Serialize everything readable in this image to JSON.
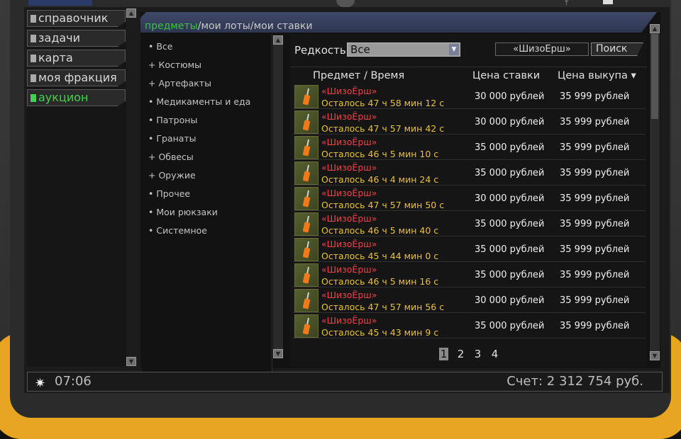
{
  "nav": {
    "items": [
      {
        "label": "справочник",
        "active": false
      },
      {
        "label": "задачи",
        "active": false
      },
      {
        "label": "карта",
        "active": false
      },
      {
        "label": "моя фракция",
        "active": false
      },
      {
        "label": "аукцион",
        "active": true
      }
    ]
  },
  "tabs": [
    {
      "label": "предметы",
      "active": true
    },
    {
      "label": "мои лоты",
      "active": false
    },
    {
      "label": "мои ставки",
      "active": false
    }
  ],
  "categories": [
    {
      "label": "• Все"
    },
    {
      "label": "+ Костюмы"
    },
    {
      "label": "+ Артефакты"
    },
    {
      "label": "• Медикаменты и еда"
    },
    {
      "label": "• Патроны"
    },
    {
      "label": "• Гранаты"
    },
    {
      "label": "+ Обвесы"
    },
    {
      "label": "+ Оружие"
    },
    {
      "label": "• Прочее"
    },
    {
      "label": "• Мои рюкзаки"
    },
    {
      "label": "• Системное"
    }
  ],
  "filter": {
    "rarity_label": "Редкость",
    "rarity_value": "Все",
    "search_value": "«ШизоЁрш»",
    "search_button": "Поиск"
  },
  "table": {
    "headers": {
      "item": "Предмет   /   Время",
      "bid": "Цена ставки",
      "buyout": "Цена выкупа ▾"
    },
    "rows": [
      {
        "name": "«ШизоЁрш»",
        "time": "Осталось 47 ч 58 мин 12 с",
        "bid": "30 000 рублей",
        "buyout": "35 999 рублей"
      },
      {
        "name": "«ШизоЁрш»",
        "time": "Осталось 47 ч 57 мин 42 с",
        "bid": "30 000 рублей",
        "buyout": "35 999 рублей"
      },
      {
        "name": "«ШизоЁрш»",
        "time": "Осталось 46 ч 5 мин 10 с",
        "bid": "35 000 рублей",
        "buyout": "35 999 рублей"
      },
      {
        "name": "«ШизоЁрш»",
        "time": "Осталось 46 ч 4 мин 24 с",
        "bid": "35 000 рублей",
        "buyout": "35 999 рублей"
      },
      {
        "name": "«ШизоЁрш»",
        "time": "Осталось 47 ч 57 мин 50 с",
        "bid": "30 000 рублей",
        "buyout": "35 999 рублей"
      },
      {
        "name": "«ШизоЁрш»",
        "time": "Осталось 46 ч 5 мин 40 с",
        "bid": "35 000 рублей",
        "buyout": "35 999 рублей"
      },
      {
        "name": "«ШизоЁрш»",
        "time": "Осталось 45 ч 44 мин 0 с",
        "bid": "35 000 рублей",
        "buyout": "35 999 рублей"
      },
      {
        "name": "«ШизоЁрш»",
        "time": "Осталось 46 ч 5 мин 16 с",
        "bid": "35 000 рублей",
        "buyout": "35 999 рублей"
      },
      {
        "name": "«ШизоЁрш»",
        "time": "Осталось 47 ч 57 мин 56 с",
        "bid": "30 000 рублей",
        "buyout": "35 999 рублей"
      },
      {
        "name": "«ШизоЁрш»",
        "time": "Осталось 45 ч 43 мин 9 с",
        "bid": "35 000 рублей",
        "buyout": "35 999 рублей"
      }
    ]
  },
  "pagination": {
    "pages": [
      "1",
      "2",
      "3",
      "4"
    ],
    "current": "1"
  },
  "status": {
    "time": "07:06",
    "money": "Счет: 2 312 754 руб."
  },
  "colors": {
    "active_green": "#3fd24a",
    "item_name": "#ee4444",
    "item_time": "#e9c23a",
    "frame_yellow": "#e7a521"
  }
}
